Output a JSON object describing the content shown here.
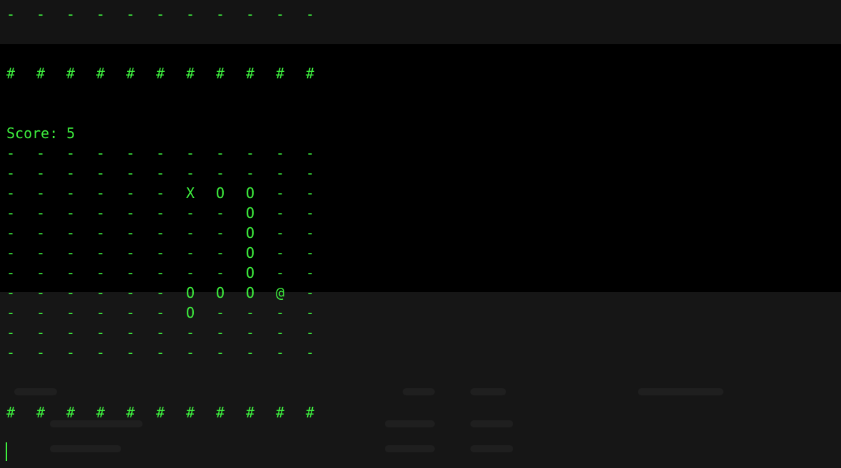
{
  "theme": {
    "foreground": "#3ef03e",
    "background": "#000000"
  },
  "score_text": "Score: 5",
  "rows": [
    {
      "id": "top-dash-row",
      "cells": [
        "-",
        "-",
        "-",
        "-",
        "-",
        "-",
        "-",
        "-",
        "-",
        "-",
        "-"
      ]
    },
    {
      "id": "top-wall",
      "cells": [
        "#",
        "#",
        "#",
        "#",
        "#",
        "#",
        "#",
        "#",
        "#",
        "#",
        "#"
      ]
    },
    {
      "id": "board-row-1",
      "cells": [
        "-",
        "-",
        "-",
        "-",
        "-",
        "-",
        "-",
        "-",
        "-",
        "-",
        "-"
      ]
    },
    {
      "id": "board-row-2",
      "cells": [
        "-",
        "-",
        "-",
        "-",
        "-",
        "-",
        "-",
        "-",
        "-",
        "-",
        "-"
      ]
    },
    {
      "id": "board-row-3",
      "cells": [
        "-",
        "-",
        "-",
        "-",
        "-",
        "-",
        "X",
        "O",
        "O",
        "-",
        "-"
      ]
    },
    {
      "id": "board-row-4",
      "cells": [
        "-",
        "-",
        "-",
        "-",
        "-",
        "-",
        "-",
        "-",
        "O",
        "-",
        "-"
      ]
    },
    {
      "id": "board-row-5",
      "cells": [
        "-",
        "-",
        "-",
        "-",
        "-",
        "-",
        "-",
        "-",
        "O",
        "-",
        "-"
      ]
    },
    {
      "id": "board-row-6",
      "cells": [
        "-",
        "-",
        "-",
        "-",
        "-",
        "-",
        "-",
        "-",
        "O",
        "-",
        "-"
      ]
    },
    {
      "id": "board-row-7",
      "cells": [
        "-",
        "-",
        "-",
        "-",
        "-",
        "-",
        "-",
        "-",
        "O",
        "-",
        "-"
      ]
    },
    {
      "id": "board-row-8",
      "cells": [
        "-",
        "-",
        "-",
        "-",
        "-",
        "-",
        "O",
        "O",
        "O",
        "@",
        "-"
      ]
    },
    {
      "id": "board-row-9",
      "cells": [
        "-",
        "-",
        "-",
        "-",
        "-",
        "-",
        "O",
        "-",
        "-",
        "-",
        "-"
      ]
    },
    {
      "id": "board-row-10",
      "cells": [
        "-",
        "-",
        "-",
        "-",
        "-",
        "-",
        "-",
        "-",
        "-",
        "-",
        "-"
      ]
    },
    {
      "id": "board-row-11",
      "cells": [
        "-",
        "-",
        "-",
        "-",
        "-",
        "-",
        "-",
        "-",
        "-",
        "-",
        "-"
      ]
    },
    {
      "id": "bottom-wall",
      "cells": [
        "#",
        "#",
        "#",
        "#",
        "#",
        "#",
        "#",
        "#",
        "#",
        "#",
        "#"
      ]
    }
  ]
}
